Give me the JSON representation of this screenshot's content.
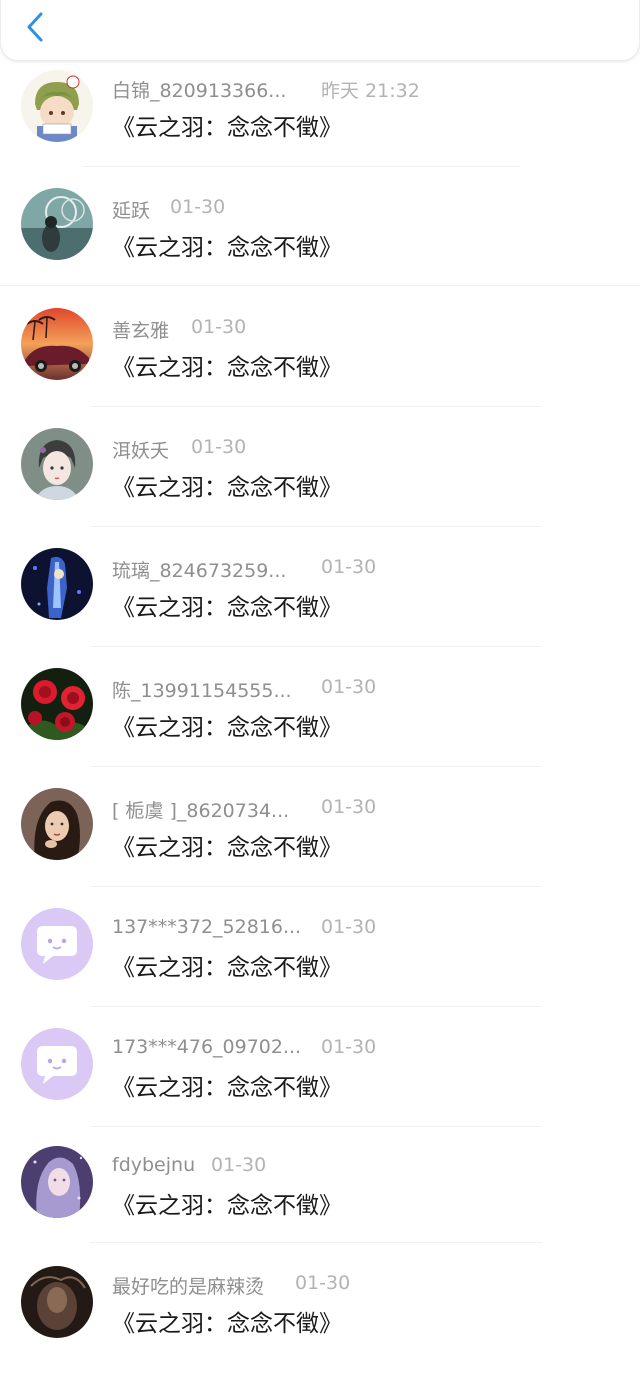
{
  "header": {
    "back_icon": "chevron-left-icon",
    "accent": "#2f8ee5"
  },
  "messages": [
    {
      "name": "白锦_820913366...",
      "time": "昨天 21:32",
      "content": "《云之羽：念念不徵》",
      "avatar": "anime-boy"
    },
    {
      "name": "延跃",
      "time": "01-30",
      "content": "《云之羽：念念不徵》",
      "avatar": "photo-teal"
    },
    {
      "name": "善玄雅",
      "time": "01-30",
      "content": "《云之羽：念念不徵》",
      "avatar": "car-sunset"
    },
    {
      "name": "洱妖夭",
      "time": "01-30",
      "content": "《云之羽：念念不徵》",
      "avatar": "ink-girl"
    },
    {
      "name": "琉璃_824673259...",
      "time": "01-30",
      "content": "《云之羽：念念不徵》",
      "avatar": "dark-blue"
    },
    {
      "name": "陈_13991154555...",
      "time": "01-30",
      "content": "《云之羽：念念不徵》",
      "avatar": "red-roses"
    },
    {
      "name": "[ 栀虞 ]_8620734...",
      "time": "01-30",
      "content": "《云之羽：念念不徵》",
      "avatar": "girl-portrait"
    },
    {
      "name": "137***372_52816...",
      "time": "01-30",
      "content": "《云之羽：念念不徵》",
      "avatar": "default-chat"
    },
    {
      "name": "173***476_09702...",
      "time": "01-30",
      "content": "《云之羽：念念不徵》",
      "avatar": "default-chat"
    },
    {
      "name": "fdybejnu",
      "time": "01-30",
      "content": "《云之羽：念念不徵》",
      "avatar": "purple-fantasy"
    },
    {
      "name": "最好吃的是麻辣烫",
      "time": "01-30",
      "content": "《云之羽：念念不徵》",
      "avatar": "dark-smoke"
    }
  ]
}
